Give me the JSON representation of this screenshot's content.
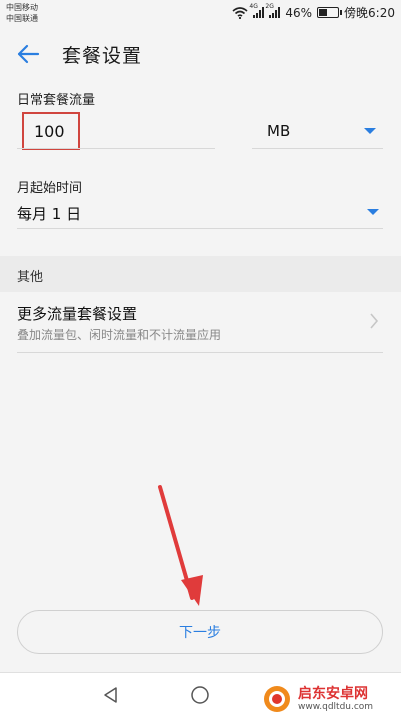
{
  "status_bar": {
    "carrier_1": "中国移动",
    "carrier_2": "中国联通",
    "signal_1_tag": "4G",
    "signal_2_tag": "2G",
    "battery_percent": "46%",
    "battery_level": 0.46,
    "time": "傍晚6:20"
  },
  "app_bar": {
    "title": "套餐设置"
  },
  "data_plan": {
    "label": "日常套餐流量",
    "value": "100",
    "unit": "MB"
  },
  "start_day": {
    "label": "月起始时间",
    "value": "每月 1 日"
  },
  "other_section": {
    "header": "其他",
    "more_title": "更多流量套餐设置",
    "more_subtitle": "叠加流量包、闲时流量和不计流量应用"
  },
  "next_button": {
    "label": "下一步"
  },
  "watermark": {
    "name": "启东安卓网",
    "url": "www.qdltdu.com"
  },
  "colors": {
    "accent": "#2a7ee0",
    "highlight_box": "#d0453e",
    "annotation_arrow": "#e03b3b"
  }
}
